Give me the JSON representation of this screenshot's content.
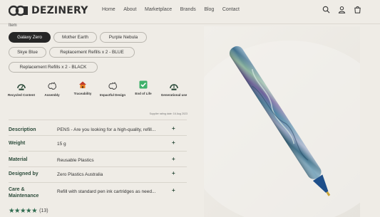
{
  "header": {
    "brand": "DEZINERY",
    "nav": [
      "Home",
      "About",
      "Marketplace",
      "Brands",
      "Blog",
      "Contact"
    ],
    "icons": [
      "search-icon",
      "account-icon",
      "cart-icon"
    ]
  },
  "variants": {
    "label": "Item",
    "options": [
      {
        "label": "Galaxy Zero",
        "selected": true
      },
      {
        "label": "Mother Earth",
        "selected": false
      },
      {
        "label": "Purple Nebula",
        "selected": false
      },
      {
        "label": "Skye Blue",
        "selected": false
      },
      {
        "label": "Replacement Refills x 2 - BLUE",
        "selected": false
      },
      {
        "label": "Replacement Refills x 2 - BLACK",
        "selected": false
      }
    ]
  },
  "features": [
    {
      "label": "Recycled Content",
      "icon": "recycled-gauge-icon"
    },
    {
      "label": "Assembly",
      "icon": "australia-map-icon"
    },
    {
      "label": "Traceability",
      "icon": "house-icon"
    },
    {
      "label": "Impactful Design",
      "icon": "australia-map-icon"
    },
    {
      "label": "End of Life",
      "icon": "checkbox-icon"
    },
    {
      "label": "Generational use",
      "icon": "generational-gauge-icon"
    }
  ],
  "supplier_rating_date": "Supplier rating date: 16 Aug 2023",
  "specs": [
    {
      "name": "Description",
      "value": "PENS - Are you looking for a high-quality, refill..."
    },
    {
      "name": "Weight",
      "value": "15 g"
    },
    {
      "name": "Material",
      "value": "Reusable Plastics"
    },
    {
      "name": "Designed by",
      "value": "Zero Plastics Australia"
    },
    {
      "name": "Care & Maintenance",
      "value": "Refill with standard pen ink cartridges as need..."
    }
  ],
  "rating": {
    "stars": "★★★★★",
    "count": "(13)",
    "value": 5
  },
  "colors": {
    "accent": "#2c4b3a",
    "star": "#2e6b4f",
    "background": "#efece6",
    "chip_active": "#262626"
  }
}
